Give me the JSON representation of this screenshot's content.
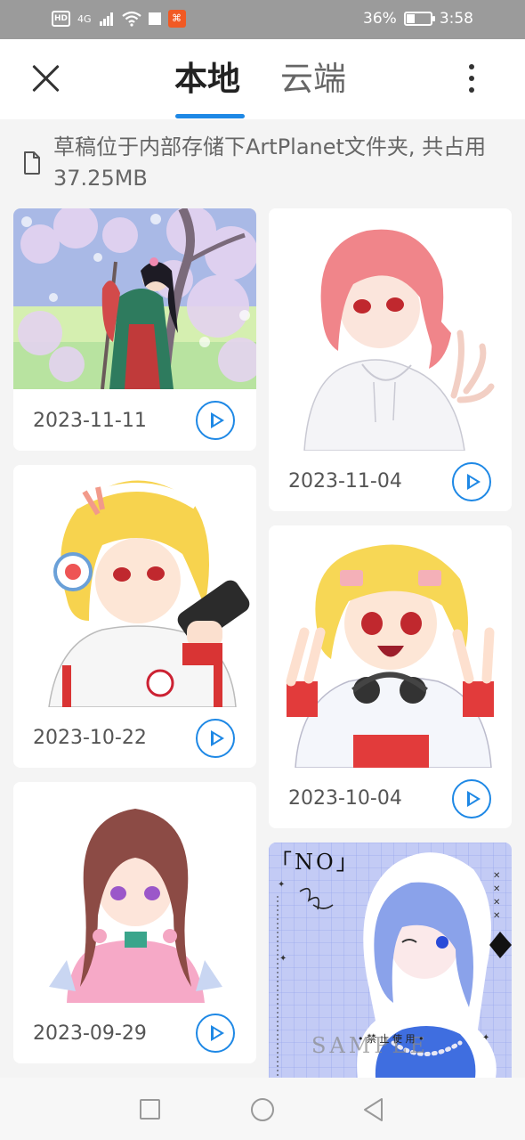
{
  "status_bar": {
    "left_badges": [
      "HD",
      "4G"
    ],
    "app_badge": "⌘",
    "battery_percent": "36%",
    "battery_level": 0.36,
    "time": "3:58"
  },
  "header": {
    "tabs": [
      {
        "label": "本地",
        "selected": true
      },
      {
        "label": "云端",
        "selected": false
      }
    ],
    "accent_color": "#1e88e5"
  },
  "info": {
    "text": "草稿位于内部存储下ArtPlanet文件夹, 共占用37.25MB"
  },
  "drafts": [
    {
      "date": "2023-11-11",
      "thumbnail": "anime girl in kimono under cherry blossom tree"
    },
    {
      "date": "2023-11-04",
      "thumbnail": "pink haired girl in white hoodie"
    },
    {
      "date": "2023-10-22",
      "thumbnail": "blonde girl with headphones holding camera"
    },
    {
      "date": "2023-10-04",
      "thumbnail": "blonde boy with headphones making peace signs"
    },
    {
      "date": "2023-09-29",
      "thumbnail": "brown haired girl in pink qipao"
    },
    {
      "date": "",
      "thumbnail": "blue haired girl sticker art on grid paper"
    }
  ],
  "artwork_text": {
    "sticker_title": "「NO」",
    "watermark": "SAMPLE",
    "ban_text": "• 禁 止 使 用 •"
  }
}
